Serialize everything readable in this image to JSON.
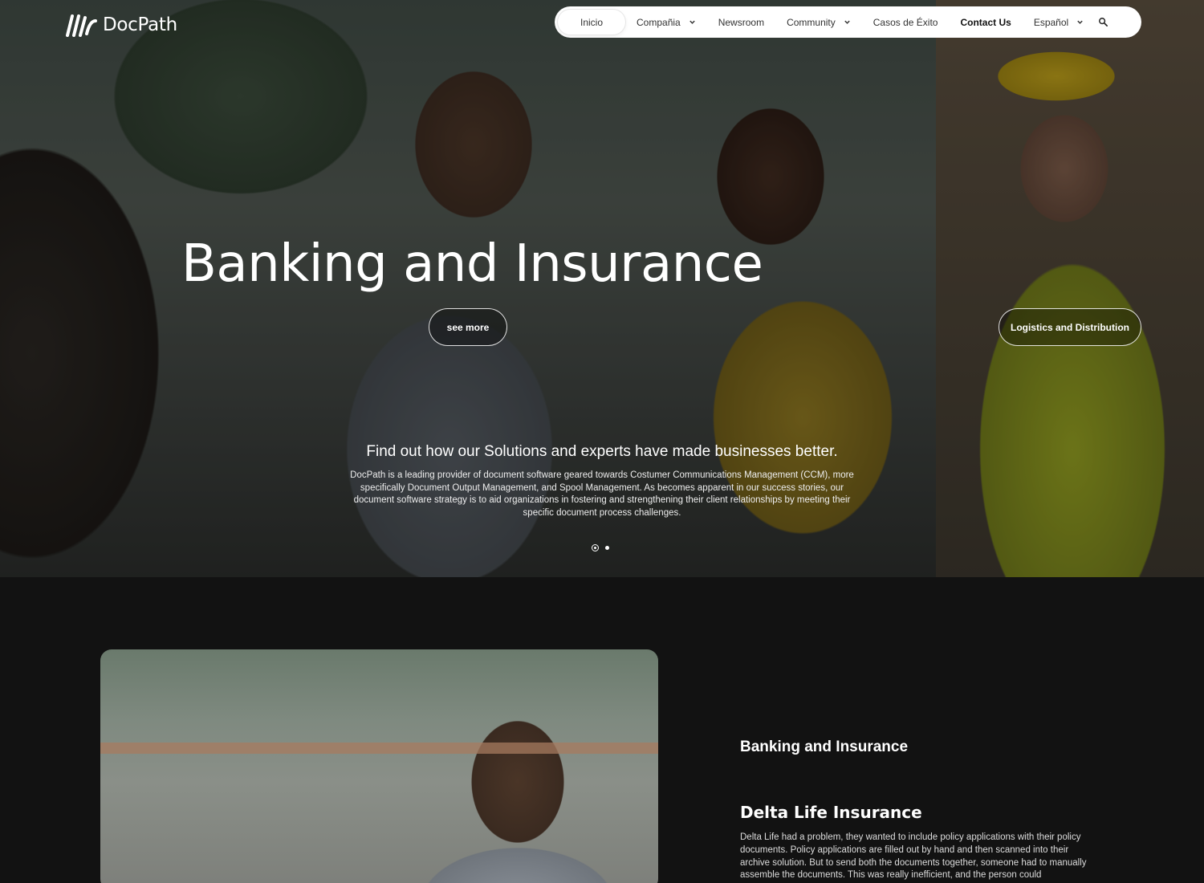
{
  "brand": {
    "name": "DocPath",
    "logo_icon": "docpath-slashes-logo"
  },
  "nav": {
    "items": [
      {
        "label": "Inicio",
        "active": true,
        "dropdown": false
      },
      {
        "label": "Compañia",
        "dropdown": true
      },
      {
        "label": "Newsroom",
        "dropdown": false
      },
      {
        "label": "Community",
        "dropdown": true
      },
      {
        "label": "Casos de Éxito",
        "dropdown": false
      },
      {
        "label": "Contact Us",
        "bold": true,
        "dropdown": false
      },
      {
        "label": "Español",
        "dropdown": true
      }
    ],
    "search_icon": "search-icon"
  },
  "hero": {
    "title": "Banking and Insurance",
    "button": "see more",
    "next_slide_button": "Logistics and Distribution",
    "subtitle": "Find out how our Solutions and experts have made businesses better.",
    "description": "DocPath is a leading provider of document software geared towards Costumer Communications Management (CCM), more specifically Document Output Management, and Spool Management. As becomes apparent in our success stories, our document software strategy is to aid organizations in fostering and strengthening their client relationships by meeting their specific document process challenges.",
    "slide_count": 2,
    "active_slide": 1
  },
  "section": {
    "category": "Banking and Insurance",
    "case_title": "Delta Life Insurance",
    "case_text": "Delta Life had a problem, they wanted to include policy applications with their policy documents. Policy applications are filled out by hand and then scanned into their archive solution. But to send both the documents together, someone had to manually assemble the documents. This was really inefficient, and the person could"
  },
  "colors": {
    "background": "#121212",
    "nav_bg": "#ffffff",
    "text": "#ffffff"
  }
}
